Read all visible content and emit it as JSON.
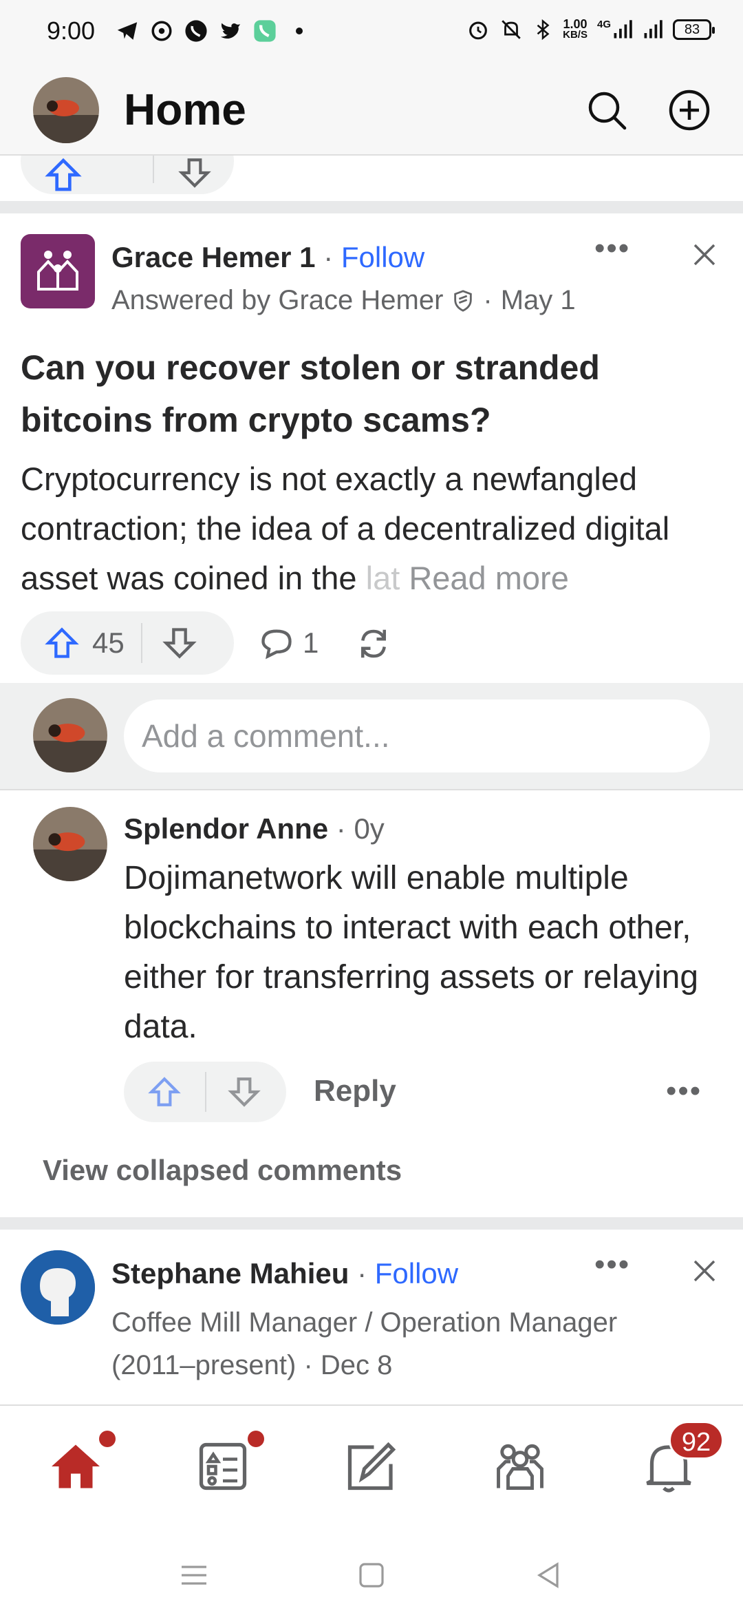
{
  "status_bar": {
    "time": "9:00",
    "network_speed_value": "1.00",
    "network_speed_unit": "KB/S",
    "network_type": "4G",
    "battery": "83"
  },
  "header": {
    "title": "Home"
  },
  "post": {
    "author": "Grace Hemer 1",
    "follow_label": "Follow",
    "answered_by": "Answered by Grace Hemer",
    "date": "May 1",
    "question": "Can you recover stolen or stranded bitcoins from crypto scams?",
    "body": "Cryptocurrency is not exactly a newfangled contraction; the idea of a decentralized digital asset was coined in the ",
    "body_faded": "lat",
    "read_more": "Read more",
    "upvotes": "45",
    "comments": "1"
  },
  "comment_box": {
    "placeholder": "Add a comment..."
  },
  "comment": {
    "author": "Splendor Anne",
    "age": "0y",
    "text": "Dojimanetwork will enable multiple blockchains to interact with each other, either for transferring assets or relaying data.",
    "reply_label": "Reply"
  },
  "view_collapsed": "View collapsed comments",
  "next_post": {
    "author": "Stephane Mahieu",
    "follow_label": "Follow",
    "credential": "Coffee Mill Manager / Operation Manager (2011–present)",
    "date": "Dec 8"
  },
  "bottom_nav": {
    "notifications_badge": "92",
    "items": [
      "home-icon",
      "following-icon",
      "answer-icon",
      "spaces-icon",
      "notifications-icon"
    ]
  },
  "colors": {
    "accent": "#2e69ff",
    "brand_red": "#b92b27",
    "text_primary": "#282829",
    "text_secondary": "#636466"
  }
}
